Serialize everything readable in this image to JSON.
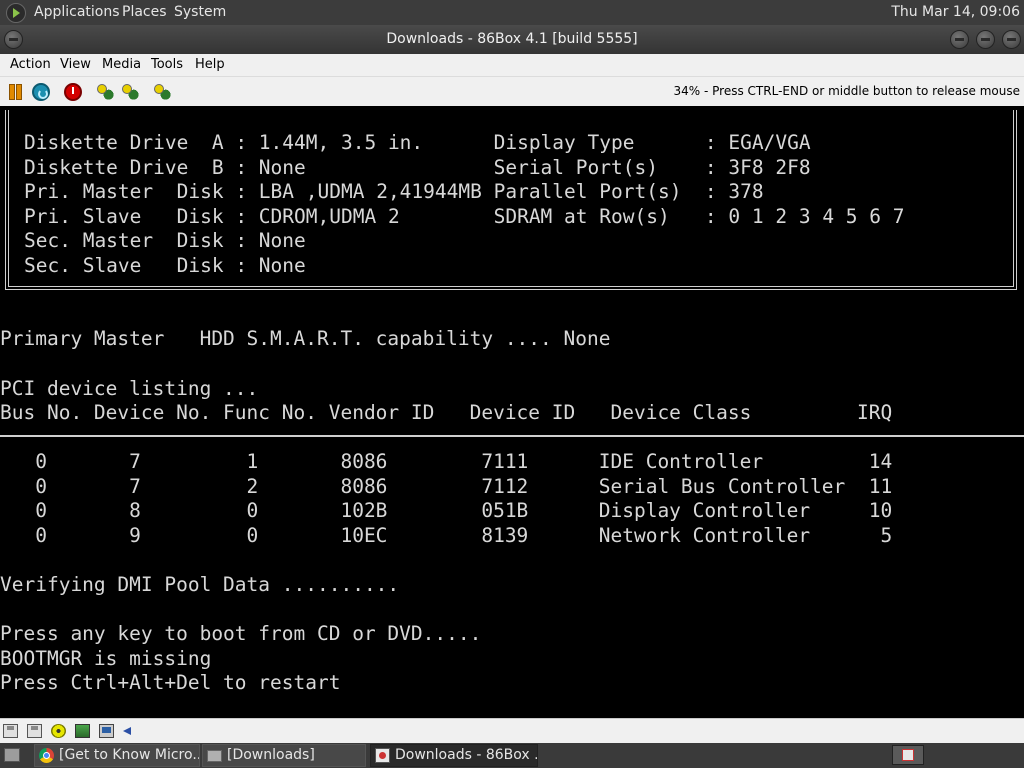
{
  "top_panel": {
    "menus": [
      "Applications",
      "Places",
      "System"
    ],
    "clock": "Thu Mar 14, 09:06"
  },
  "window": {
    "title": "Downloads - 86Box 4.1 [build 5555]"
  },
  "menubar": [
    "Action",
    "View",
    "Media",
    "Tools",
    "Help"
  ],
  "toolbar": {
    "icons": [
      "pause-icon",
      "reset-icon",
      "power-icon",
      "ctrl-alt-del-icon",
      "ctrl-alt-esc-icon",
      "settings-icon"
    ],
    "status": "34% - Press CTRL-END or middle button to release mouse"
  },
  "screen": {
    "config_box_lines": [
      "Diskette Drive  A : 1.44M, 3.5 in.      Display Type      : EGA/VGA",
      "Diskette Drive  B : None                Serial Port(s)    : 3F8 2F8",
      "Pri. Master  Disk : LBA ,UDMA 2,41944MB Parallel Port(s)  : 378",
      "Pri. Slave   Disk : CDROM,UDMA 2        SDRAM at Row(s)   : 0 1 2 3 4 5 6 7",
      "Sec. Master  Disk : None",
      "Sec. Slave   Disk : None"
    ],
    "smart_line": "Primary Master   HDD S.M.A.R.T. capability .... None",
    "pci_title": "PCI device listing ...",
    "pci_header": "Bus No. Device No. Func No. Vendor ID   Device ID   Device Class         IRQ",
    "pci_rows": [
      "   0       7         1       8086        7111      IDE Controller         14",
      "   0       7         2       8086        7112      Serial Bus Controller  11",
      "   0       8         0       102B        051B      Display Controller     10",
      "   0       9         0       10EC        8139      Network Controller      5"
    ],
    "dmi_line": "Verifying DMI Pool Data ..........",
    "boot_lines": [
      "Press any key to boot from CD or DVD.....",
      "BOOTMGR is missing",
      "Press Ctrl+Alt+Del to restart"
    ]
  },
  "statusbar": {
    "icons": [
      "floppy-a-icon",
      "floppy-b-icon",
      "cdrom-icon",
      "network-icon",
      "display-icon",
      "sound-icon"
    ]
  },
  "taskbar": {
    "tasks": [
      {
        "label": "[Get to Know Micro...",
        "icon": "chrome-icon"
      },
      {
        "label": "[Downloads]",
        "icon": "folder-icon"
      },
      {
        "label": "Downloads - 86Box ...",
        "icon": "86box-icon"
      }
    ],
    "tray_icon": "86box-tray-icon"
  }
}
